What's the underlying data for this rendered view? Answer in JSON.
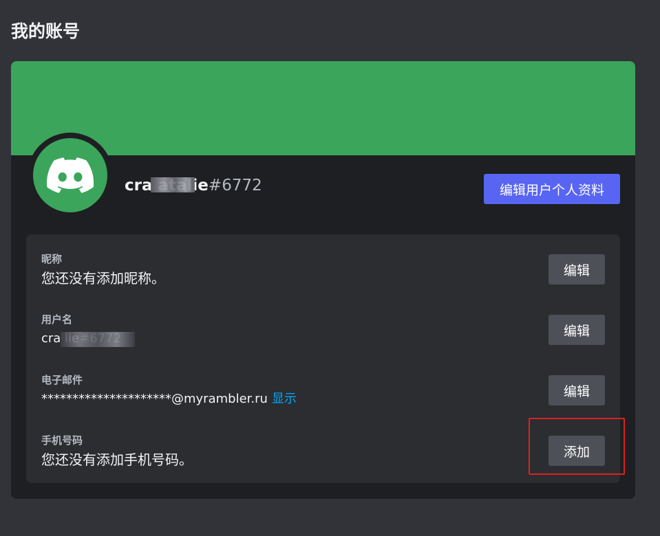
{
  "page": {
    "title": "我的账号"
  },
  "colors": {
    "banner": "#3ba55c",
    "avatar_bg": "#3ba55c",
    "primary_button": "#5865f2",
    "secondary_button": "#4e5058",
    "link": "#00a8fc",
    "highlight": "#e02020"
  },
  "profile": {
    "display_name": "cra          atalie",
    "discriminator": "#6772",
    "avatar_icon": "discord-logo-icon",
    "edit_profile_label": "编辑用户个人资料"
  },
  "fields": {
    "nickname": {
      "label": "昵称",
      "value": "您还没有添加昵称。",
      "button": "编辑"
    },
    "username": {
      "label": "用户名",
      "value": "cra          lie",
      "discriminator": "#6772",
      "button": "编辑"
    },
    "email": {
      "label": "电子邮件",
      "value": "*********************@myrambler.ru",
      "reveal_label": "显示",
      "button": "编辑"
    },
    "phone": {
      "label": "手机号码",
      "value": "您还没有添加手机号码。",
      "button": "添加"
    }
  }
}
